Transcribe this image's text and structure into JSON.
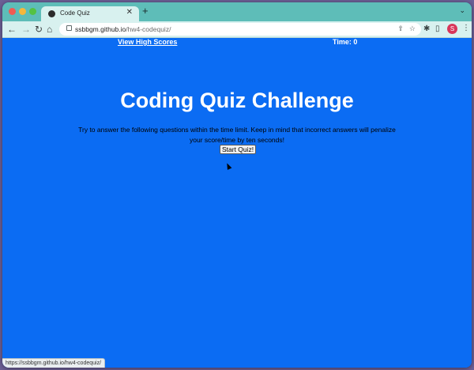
{
  "browser": {
    "tab": {
      "title": "Code Quiz",
      "close": "✕"
    },
    "new_tab": "+",
    "tabs_menu": "⌄",
    "nav": {
      "back": "←",
      "forward": "→",
      "reload": "↻",
      "home": "⌂"
    },
    "address": {
      "host": "ssbbgm.github.io",
      "path": "/hw4-codequiz/"
    },
    "toolbar_icons": {
      "share": "⇪",
      "star": "☆",
      "extensions": "✱",
      "sidebar": "▯",
      "menu": "⋮"
    },
    "profile_initial": "S",
    "status_url": "https://ssbbgm.github.io/hw4-codequiz/"
  },
  "page": {
    "high_scores_link": "View High Scores",
    "timer": "Time: 0",
    "title": "Coding Quiz Challenge",
    "intro": "Try to answer the following questions within the time limit. Keep in mind that incorrect answers will penalize your score/time by ten seconds!",
    "start_button": "Start Quiz!"
  },
  "colors": {
    "page_background": "#0b6cf3",
    "tab_strip": "#5ebdb8",
    "toolbar": "#d8f1ef",
    "profile": "#d8365a"
  }
}
